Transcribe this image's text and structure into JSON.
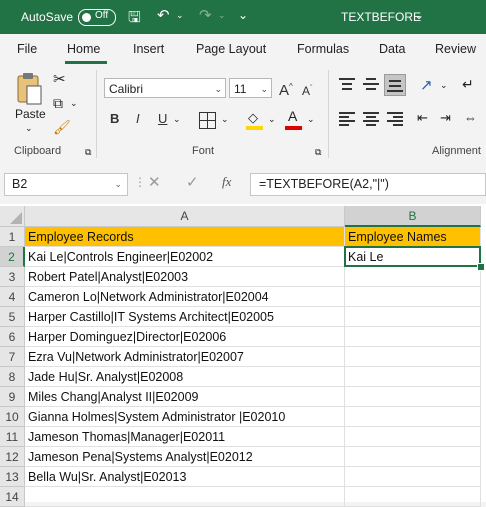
{
  "titlebar": {
    "autosave_label": "AutoSave",
    "toggle_state": "Off",
    "filename": "TEXTBEFORE"
  },
  "tabs": [
    "File",
    "Home",
    "Insert",
    "Page Layout",
    "Formulas",
    "Data",
    "Review"
  ],
  "ribbon": {
    "paste_label": "Paste",
    "clipboard_label": "Clipboard",
    "font_name": "Calibri",
    "font_size": "11",
    "font_label": "Font",
    "alignment_label": "Alignment",
    "bold": "B",
    "italic": "I",
    "underline": "U",
    "grow_font": "A",
    "shrink_font": "A",
    "font_color": "A",
    "accent_fill": "#ffd700",
    "accent_font": "#e00000"
  },
  "formula_bar": {
    "name_box": "B2",
    "fx": "fx",
    "formula": "=TEXTBEFORE(A2,\"|\")"
  },
  "sheet": {
    "columns": [
      "A",
      "B"
    ],
    "rows": [
      {
        "num": "1",
        "a": "Employee Records",
        "b": "Employee Names"
      },
      {
        "num": "2",
        "a": "Kai Le|Controls Engineer|E02002",
        "b": "Kai Le"
      },
      {
        "num": "3",
        "a": "Robert Patel|Analyst|E02003",
        "b": ""
      },
      {
        "num": "4",
        "a": "Cameron Lo|Network Administrator|E02004",
        "b": ""
      },
      {
        "num": "5",
        "a": "Harper Castillo|IT Systems Architect|E02005",
        "b": ""
      },
      {
        "num": "6",
        "a": "Harper Dominguez|Director|E02006",
        "b": ""
      },
      {
        "num": "7",
        "a": "Ezra Vu|Network Administrator|E02007",
        "b": ""
      },
      {
        "num": "8",
        "a": "Jade Hu|Sr. Analyst|E02008",
        "b": ""
      },
      {
        "num": "9",
        "a": "Miles Chang|Analyst II|E02009",
        "b": ""
      },
      {
        "num": "10",
        "a": "Gianna Holmes|System Administrator |E02010",
        "b": ""
      },
      {
        "num": "11",
        "a": "Jameson Thomas|Manager|E02011",
        "b": ""
      },
      {
        "num": "12",
        "a": "Jameson Pena|Systems Analyst|E02012",
        "b": ""
      },
      {
        "num": "13",
        "a": "Bella Wu|Sr. Analyst|E02013",
        "b": ""
      },
      {
        "num": "14",
        "a": "",
        "b": ""
      }
    ]
  }
}
